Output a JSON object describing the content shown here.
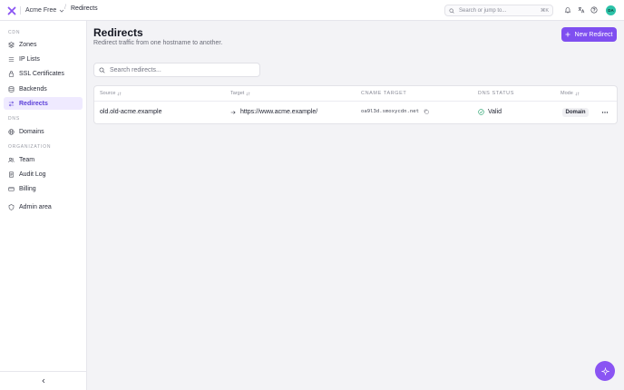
{
  "header": {
    "workspace": "Acme Free",
    "breadcrumb_separator": "/",
    "breadcrumb_current": "Redirects",
    "search_placeholder": "Search or jump to...",
    "search_shortcut": "⌘K",
    "avatar_initials": "DA",
    "icons": [
      "bell-icon",
      "translate-icon",
      "help-icon"
    ]
  },
  "sidebar": {
    "sections": [
      {
        "label": "CDN",
        "items": [
          {
            "label": "Zones",
            "icon": "zones-icon"
          },
          {
            "label": "IP Lists",
            "icon": "ip-list-icon"
          },
          {
            "label": "SSL Certificates",
            "icon": "certificate-icon"
          },
          {
            "label": "Backends",
            "icon": "backends-icon"
          },
          {
            "label": "Redirects",
            "icon": "redirect-icon",
            "active": true
          }
        ]
      },
      {
        "label": "DNS",
        "items": [
          {
            "label": "Domains",
            "icon": "globe-icon"
          }
        ]
      },
      {
        "label": "ORGANIZATION",
        "items": [
          {
            "label": "Team",
            "icon": "team-icon"
          },
          {
            "label": "Audit Log",
            "icon": "audit-log-icon"
          },
          {
            "label": "Billing",
            "icon": "billing-icon"
          }
        ]
      }
    ],
    "admin": {
      "label": "Admin area",
      "icon": "shield-icon"
    }
  },
  "page": {
    "title": "Redirects",
    "subtitle": "Redirect traffic from one hostname to another.",
    "new_button_label": "New Redirect",
    "filter_placeholder": "Search redirects..."
  },
  "table": {
    "columns": [
      {
        "label": "Source",
        "sortable": true
      },
      {
        "label": "Target",
        "sortable": true
      },
      {
        "label": "CNAME TARGET",
        "sortable": false
      },
      {
        "label": "DNS STATUS",
        "sortable": false
      },
      {
        "label": "Mode",
        "sortable": true
      }
    ],
    "rows": [
      {
        "source": "old.old-acme.example",
        "target": "https://www.acme.example/",
        "cname_target": "oa9l3d.smoxycdn.net",
        "dns_status": "Valid",
        "mode": "Domain"
      }
    ]
  },
  "colors": {
    "accent": "#7f4ff0",
    "active_nav_bg": "#efeaff",
    "status_valid": "#22a06b",
    "avatar_bg": "#2cc2a8"
  }
}
